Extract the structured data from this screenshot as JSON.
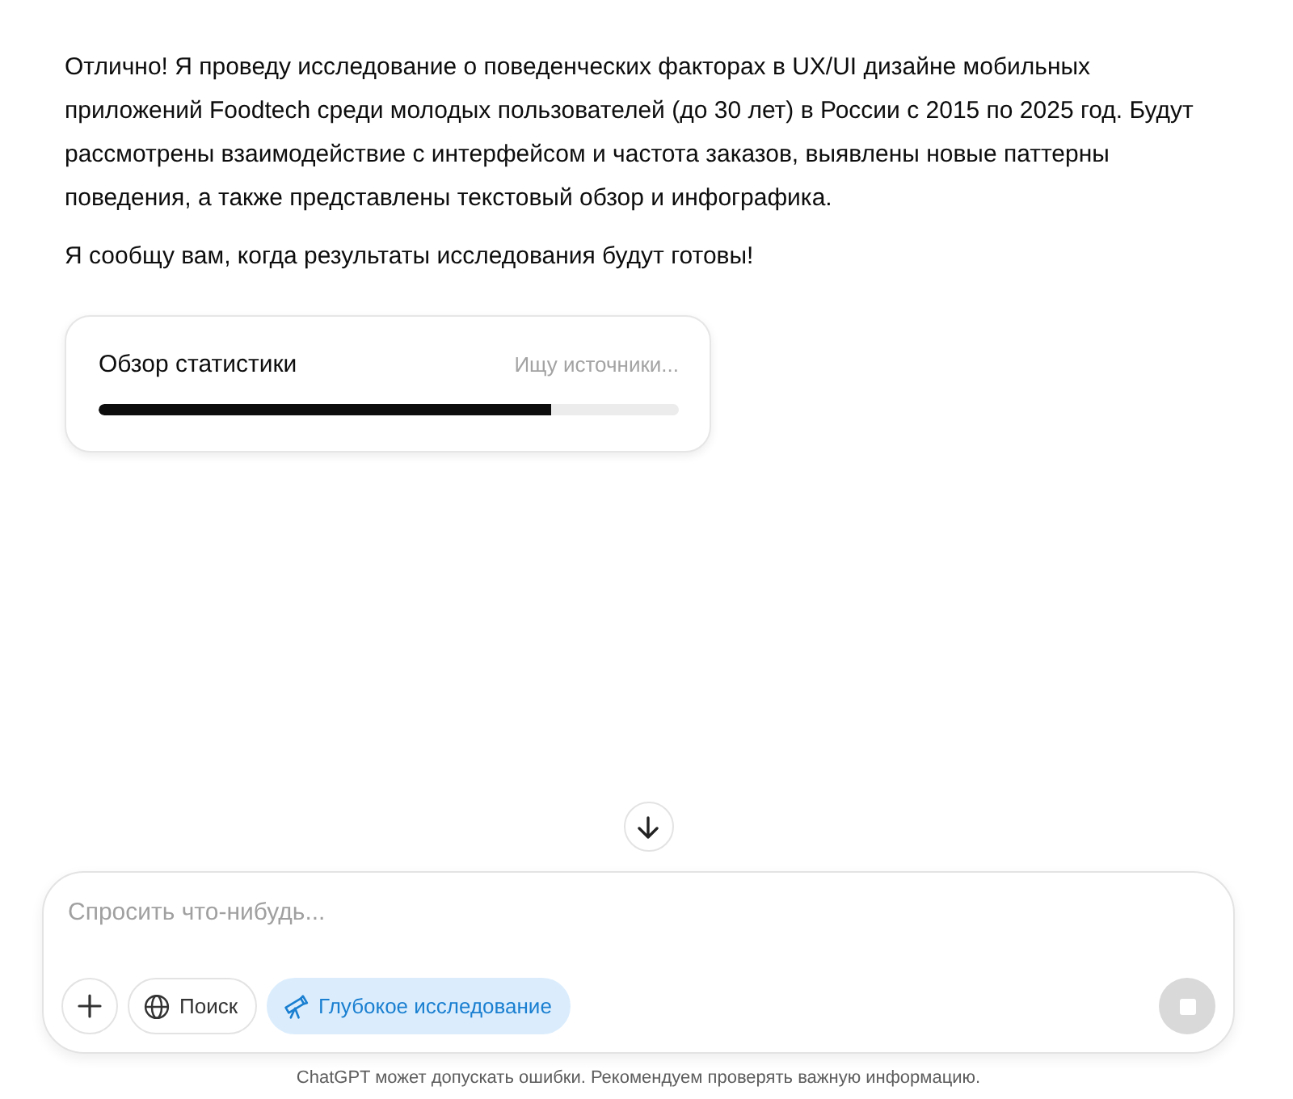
{
  "message": {
    "paragraphs": [
      "Отлично! Я проведу исследование о поведенческих факторах в UX/UI дизайне мобильных приложений Foodtech среди молодых пользователей (до 30 лет) в России с 2015 по 2025 год. Будут рассмотрены взаимодействие с интерфейсом и частота заказов, выявлены новые паттерны поведения, а также представлены текстовый обзор и инфографика.",
      "Я сообщу вам, когда результаты исследования будут готовы!"
    ]
  },
  "task_card": {
    "title": "Обзор статистики",
    "status": "Ищу источники...",
    "level": 0.78
  },
  "composer": {
    "placeholder": "Спросить что-нибудь...",
    "tools": [
      {
        "kind": "search",
        "label": "Поиск",
        "selected": false
      },
      {
        "kind": "research",
        "label": "Глубокое исследование",
        "selected": true
      }
    ],
    "stop_button": {
      "disabled": true
    }
  },
  "footer": "ChatGPT может допускать ошибки. Рекомендуем проверять важную информацию."
}
